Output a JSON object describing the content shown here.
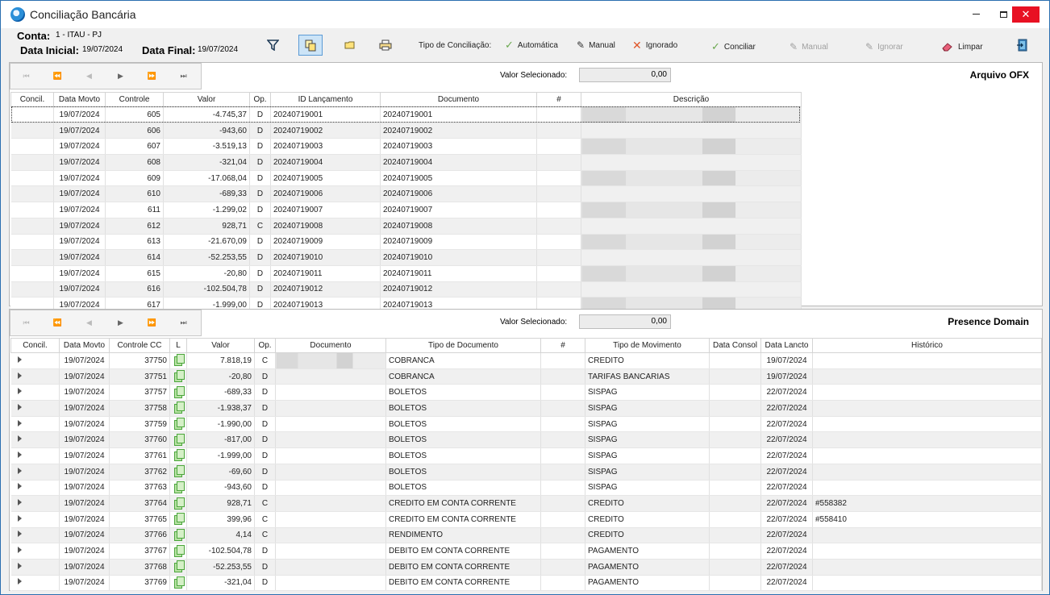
{
  "window": {
    "title": "Conciliação Bancária",
    "close_glyph": "✕",
    "min_glyph": "",
    "max_glyph": ""
  },
  "header": {
    "conta_label": "Conta:",
    "conta_value": "1 - ITAU - PJ",
    "data_inicial_label": "Data Inicial:",
    "data_inicial_value": "19/07/2024",
    "data_final_label": "Data Final:",
    "data_final_value": "19/07/2024",
    "tipo_label": "Tipo de Conciliação:",
    "automatica": "Automática",
    "manual": "Manual",
    "ignorado": "Ignorado",
    "conciliar": "Conciliar",
    "manual_action": "Manual",
    "ignorar": "Ignorar",
    "limpar": "Limpar"
  },
  "ofx": {
    "title": "Arquivo OFX",
    "valor_label": "Valor Selecionado:",
    "valor_value": "0,00",
    "columns": [
      "Concil.",
      "Data Movto",
      "Controle",
      "Valor",
      "Op.",
      "ID Lançamento",
      "Documento",
      "#",
      "Descrição"
    ],
    "rows": [
      [
        "",
        "19/07/2024",
        "605",
        "-4.745,37",
        "D",
        "20240719001",
        "20240719001",
        ""
      ],
      [
        "",
        "19/07/2024",
        "606",
        "-943,60",
        "D",
        "20240719002",
        "20240719002",
        ""
      ],
      [
        "",
        "19/07/2024",
        "607",
        "-3.519,13",
        "D",
        "20240719003",
        "20240719003",
        ""
      ],
      [
        "",
        "19/07/2024",
        "608",
        "-321,04",
        "D",
        "20240719004",
        "20240719004",
        ""
      ],
      [
        "",
        "19/07/2024",
        "609",
        "-17.068,04",
        "D",
        "20240719005",
        "20240719005",
        ""
      ],
      [
        "",
        "19/07/2024",
        "610",
        "-689,33",
        "D",
        "20240719006",
        "20240719006",
        ""
      ],
      [
        "",
        "19/07/2024",
        "611",
        "-1.299,02",
        "D",
        "20240719007",
        "20240719007",
        ""
      ],
      [
        "",
        "19/07/2024",
        "612",
        "928,71",
        "C",
        "20240719008",
        "20240719008",
        ""
      ],
      [
        "",
        "19/07/2024",
        "613",
        "-21.670,09",
        "D",
        "20240719009",
        "20240719009",
        ""
      ],
      [
        "",
        "19/07/2024",
        "614",
        "-52.253,55",
        "D",
        "20240719010",
        "20240719010",
        ""
      ],
      [
        "",
        "19/07/2024",
        "615",
        "-20,80",
        "D",
        "20240719011",
        "20240719011",
        ""
      ],
      [
        "",
        "19/07/2024",
        "616",
        "-102.504,78",
        "D",
        "20240719012",
        "20240719012",
        ""
      ],
      [
        "",
        "19/07/2024",
        "617",
        "-1.999,00",
        "D",
        "20240719013",
        "20240719013",
        ""
      ]
    ]
  },
  "presence": {
    "title": "Presence Domain",
    "valor_label": "Valor Selecionado:",
    "valor_value": "0,00",
    "columns": [
      "Concil.",
      "Data Movto",
      "Controle CC",
      "L",
      "Valor",
      "Op.",
      "Documento",
      "Tipo de Documento",
      "#",
      "Tipo de Movimento",
      "Data Consol",
      "Data Lancto",
      "Histórico"
    ],
    "rows": [
      [
        "19/07/2024",
        "37750",
        "7.818,19",
        "C",
        "",
        "COBRANCA",
        "",
        "CREDITO",
        "",
        "19/07/2024",
        ""
      ],
      [
        "19/07/2024",
        "37751",
        "-20,80",
        "D",
        "",
        "COBRANCA",
        "",
        "TARIFAS BANCARIAS",
        "",
        "19/07/2024",
        ""
      ],
      [
        "19/07/2024",
        "37757",
        "-689,33",
        "D",
        "",
        "BOLETOS",
        "",
        "SISPAG",
        "",
        "22/07/2024",
        ""
      ],
      [
        "19/07/2024",
        "37758",
        "-1.938,37",
        "D",
        "",
        "BOLETOS",
        "",
        "SISPAG",
        "",
        "22/07/2024",
        ""
      ],
      [
        "19/07/2024",
        "37759",
        "-1.990,00",
        "D",
        "",
        "BOLETOS",
        "",
        "SISPAG",
        "",
        "22/07/2024",
        ""
      ],
      [
        "19/07/2024",
        "37760",
        "-817,00",
        "D",
        "",
        "BOLETOS",
        "",
        "SISPAG",
        "",
        "22/07/2024",
        ""
      ],
      [
        "19/07/2024",
        "37761",
        "-1.999,00",
        "D",
        "",
        "BOLETOS",
        "",
        "SISPAG",
        "",
        "22/07/2024",
        ""
      ],
      [
        "19/07/2024",
        "37762",
        "-69,60",
        "D",
        "",
        "BOLETOS",
        "",
        "SISPAG",
        "",
        "22/07/2024",
        ""
      ],
      [
        "19/07/2024",
        "37763",
        "-943,60",
        "D",
        "",
        "BOLETOS",
        "",
        "SISPAG",
        "",
        "22/07/2024",
        ""
      ],
      [
        "19/07/2024",
        "37764",
        "928,71",
        "C",
        "",
        "CREDITO EM CONTA CORRENTE",
        "",
        "CREDITO",
        "",
        "22/07/2024",
        "#558382"
      ],
      [
        "19/07/2024",
        "37765",
        "399,96",
        "C",
        "",
        "CREDITO EM CONTA CORRENTE",
        "",
        "CREDITO",
        "",
        "22/07/2024",
        "#558410"
      ],
      [
        "19/07/2024",
        "37766",
        "4,14",
        "C",
        "",
        "RENDIMENTO",
        "",
        "CREDITO",
        "",
        "22/07/2024",
        ""
      ],
      [
        "19/07/2024",
        "37767",
        "-102.504,78",
        "D",
        "",
        "DEBITO EM CONTA CORRENTE",
        "",
        "PAGAMENTO",
        "",
        "22/07/2024",
        ""
      ],
      [
        "19/07/2024",
        "37768",
        "-52.253,55",
        "D",
        "",
        "DEBITO EM CONTA CORRENTE",
        "",
        "PAGAMENTO",
        "",
        "22/07/2024",
        ""
      ],
      [
        "19/07/2024",
        "37769",
        "-321,04",
        "D",
        "",
        "DEBITO EM CONTA CORRENTE",
        "",
        "PAGAMENTO",
        "",
        "22/07/2024",
        ""
      ]
    ]
  },
  "colors": {
    "accent": "#2a6fb0",
    "close": "#e81123",
    "check": "#6aa84f",
    "cross": "#e0572a"
  }
}
